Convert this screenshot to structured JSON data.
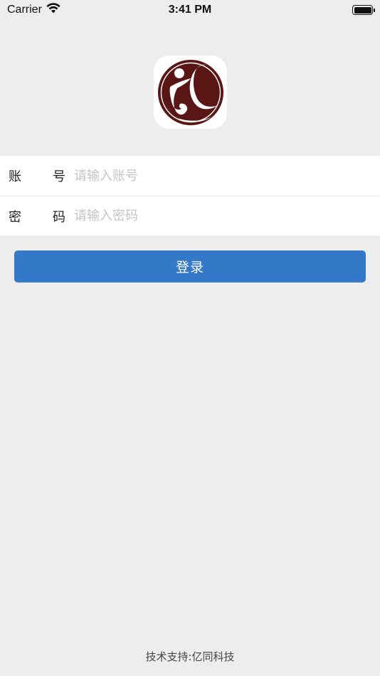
{
  "status_bar": {
    "carrier": "Carrier",
    "time": "3:41 PM",
    "wifi_icon": "wifi-icon",
    "battery_icon": "battery-icon"
  },
  "logo": {
    "icon": "app-logo",
    "colors": {
      "disc": "#5a1515",
      "tile": "#ffffff"
    }
  },
  "form": {
    "account": {
      "label_chars": [
        "账",
        "号"
      ],
      "placeholder": "请输入账号",
      "value": ""
    },
    "password": {
      "label_chars": [
        "密",
        "码"
      ],
      "placeholder": "请输入密码",
      "value": ""
    }
  },
  "login_button": {
    "label": "登录",
    "color": "#3478c8"
  },
  "footer": {
    "text": "技术支持:亿同科技"
  }
}
